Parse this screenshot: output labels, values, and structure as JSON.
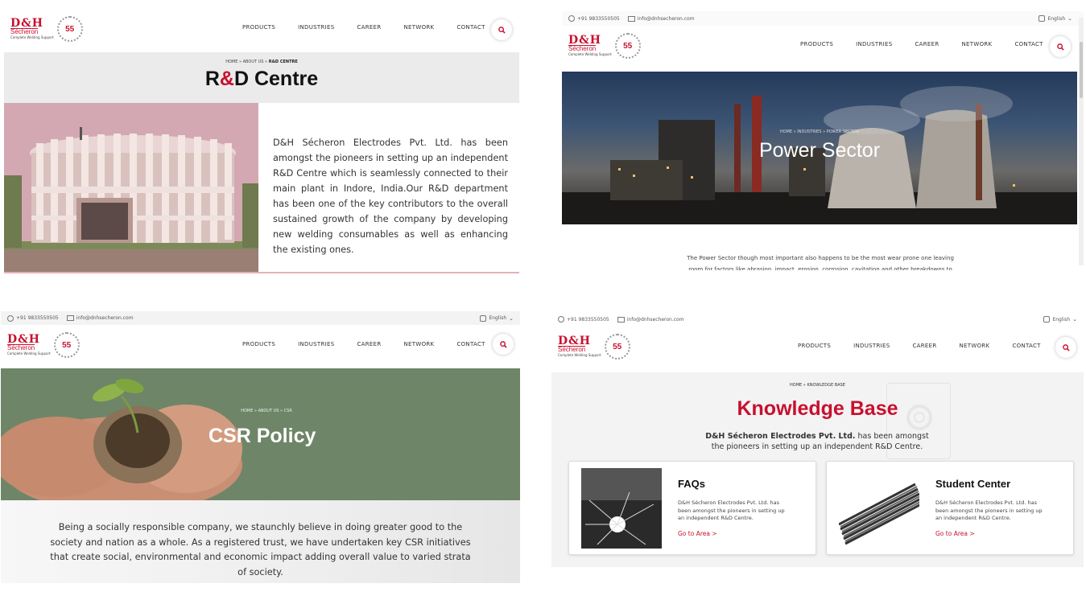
{
  "brand": {
    "logo_top": "D&H",
    "logo_name": "Sécheron",
    "logo_tagline": "Complete Welding Support",
    "anniversary": "55",
    "accent": "#c8102e"
  },
  "contact": {
    "phone": "+91 9833550505",
    "email": "info@dnhsecheron.com"
  },
  "language": {
    "selected": "English"
  },
  "nav": {
    "products": "PRODUCTS",
    "industries": "INDUSTRIES",
    "career": "CAREER",
    "network": "NETWORK",
    "contact": "CONTACT"
  },
  "rd": {
    "breadcrumb": {
      "home": "HOME",
      "sep1": " » ",
      "about": "ABOUT US",
      "sep2": " » ",
      "current": "R&D CENTRE"
    },
    "title_pre": "R",
    "title_amp": "&",
    "title_post": "D Centre",
    "description": "D&H Sécheron Electrodes Pvt. Ltd. has been amongst the pioneers in setting up an independent R&D Centre which is seamlessly connected to their main plant in Indore, India.Our R&D department has been one of the key contributors to the overall sustained growth of the company by developing new welding consumables as well as enhancing the existing ones."
  },
  "power": {
    "breadcrumb": "HOME » INDUSTRIES » POWER SECTOR",
    "title": "Power Sector",
    "description": "The Power Sector though most important also happens to be the most wear prone one leaving room for factors like abrasion, impact, erosion, corrosion, cavitation and other breakdowns to affect the"
  },
  "csr": {
    "breadcrumb": "HOME » ABOUT US » CSR",
    "title": "CSR Policy",
    "description": "Being a socially responsible company, we staunchly believe in doing greater good to the society and nation as a whole. As a registered trust, we have undertaken key CSR initiatives that create social, environmental and economic impact adding overall value to varied strata of society."
  },
  "kb": {
    "breadcrumb": "HOME » KNOWLEDGE BASE",
    "title": "Knowledge Base",
    "subtitle_bold": "D&H Sécheron Electrodes Pvt. Ltd.",
    "subtitle_rest": " has been amongst the pioneers in setting up an independent R&D Centre.",
    "cards": [
      {
        "title": "FAQs",
        "text": "D&H Sécheron Electrodes Pvt. Ltd. has been amongst the pioneers in setting up an independent R&D Centre.",
        "link": "Go to Area >"
      },
      {
        "title": "Student Center",
        "text": "D&H Sécheron Electrodes Pvt. Ltd. has been amongst the pioneers in setting up an independent R&D Centre.",
        "link": "Go to Area >"
      }
    ]
  }
}
